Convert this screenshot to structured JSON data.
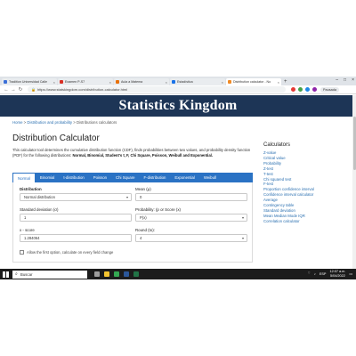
{
  "browser": {
    "tabs": [
      {
        "title": "Tradition Universidad Calle",
        "color": "#3b6fd8",
        "active": false
      },
      {
        "title": "Examen P-S7",
        "color": "#d93025",
        "active": false
      },
      {
        "title": "Aula a Matema",
        "color": "#e8710a",
        "active": false
      },
      {
        "title": "Estadística",
        "color": "#1a73e8",
        "active": false
      },
      {
        "title": "Distribution calculator - No",
        "color": "#f08a24",
        "active": true
      }
    ],
    "new_tab": "+",
    "url": "https://www.statskingdom.com/distribution-calculator.html",
    "profile": "Pausada"
  },
  "site": {
    "title": "Statistics Kingdom",
    "breadcrumb": {
      "home": "Home",
      "sep1": ">",
      "parent": "Distribution and probability",
      "sep2": ">",
      "current": "Distributions calculators"
    }
  },
  "page": {
    "title": "Distribution Calculator",
    "intro_plain": "This calculator tool determines the cumulative distribution function (CDF), finds probabilities between two values, and probability density function (PDF) for the following distributions: ",
    "intro_bold": "Normal, Binomial, Student's t, F, Chi Square, Poisson, Weibull and Exponential."
  },
  "calc_tabs": [
    "Normal",
    "Binomial",
    "t-distribution",
    "Poisson",
    "Chi Square",
    "F-distribution",
    "Exponential",
    "Weibull"
  ],
  "form": {
    "distribution_label": "Distribution",
    "distribution_value": "Normal distribution",
    "mean_label": "Mean (μ)",
    "mean_value": "0",
    "sd_label": "Standard deviation (σ)",
    "sd_value": "1",
    "prob_label": "Probability: (p or Score (x)",
    "prob_value": "P(x)",
    "xscore_label": "x - score",
    "xscore_value": "1.284064",
    "round_label": "Round (to):",
    "round_value": "4",
    "checkbox_label": "Allow the first option, calculate on every field change"
  },
  "sidebar": {
    "heading": "Calculators",
    "items": [
      "Z-value",
      "Critical value",
      "Probability",
      "Z-test",
      "T-test",
      "Chi squared test",
      "F-test",
      "Proportion confidence interval",
      "Confidence interval calculator",
      "Average",
      "Contingency table",
      "Standard deviation",
      "Mean Median Mode IQR",
      "Correlation calculator"
    ]
  },
  "taskbar": {
    "search_placeholder": "Buscar",
    "lang": "ESP",
    "time": "12:07 a.m.",
    "date": "5/04/2022"
  }
}
